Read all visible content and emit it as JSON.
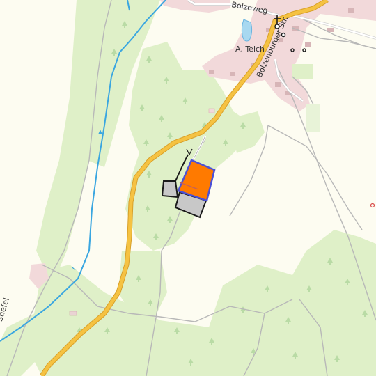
{
  "labels": {
    "bolzeweg": "Bolzeweg",
    "teich": "A. Teich",
    "bolzenburger": "Bolzenburger Str.",
    "stiefel": "Stiefel"
  },
  "colors": {
    "background": "#fdfcf1",
    "forest": "#dff0c8",
    "forest_symbol": "#b9dba5",
    "village": "#f2d9da",
    "road_primary": "#f5c242",
    "road_primary_casing": "#d8a02a",
    "stream": "#3aa6e0",
    "track": "#b8b8b8",
    "highlight_fill": "#ff7a00",
    "highlight_border": "#4b50d6",
    "building": "#c8c8c8",
    "building_outline": "#1a1a1a"
  },
  "icons": [
    "tree-icon",
    "church-icon",
    "circle-marker-icon",
    "arrow-icon"
  ]
}
